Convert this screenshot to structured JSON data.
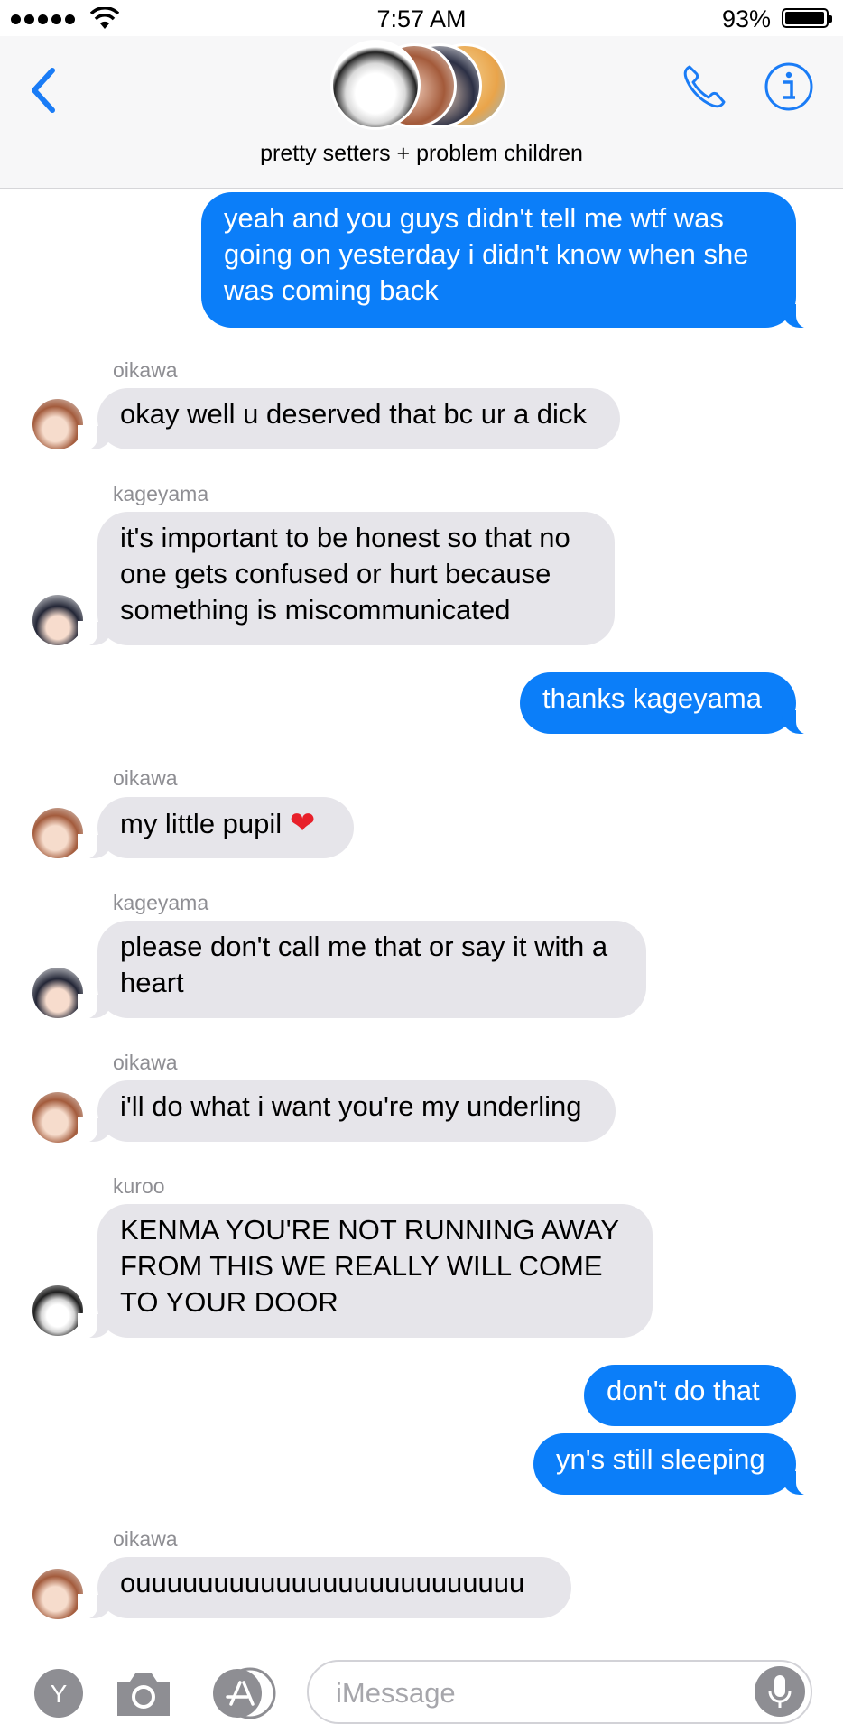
{
  "status_bar": {
    "time": "7:57 AM",
    "battery": "93%"
  },
  "header": {
    "group_name": "pretty setters + problem children",
    "icons": [
      "back-chevron-icon",
      "phone-icon",
      "info-icon"
    ]
  },
  "messages": [
    {
      "from": "me",
      "text_lines": [
        "yeah and you guys didn't tell me wtf was",
        "going on yesterday i didn't know when she",
        "was coming back"
      ]
    },
    {
      "from": "oikawa",
      "sender": "oikawa",
      "text": "okay well u deserved that bc ur a dick"
    },
    {
      "from": "kageyama",
      "sender": "kageyama",
      "text_lines": [
        "it's important to be honest so that no",
        "one gets confused or hurt because",
        "something is miscommunicated"
      ]
    },
    {
      "from": "me",
      "text": "thanks kageyama"
    },
    {
      "from": "oikawa",
      "sender": "oikawa",
      "text": "my little pupil",
      "emoji": "❤"
    },
    {
      "from": "kageyama",
      "sender": "kageyama",
      "text_lines": [
        "please don't call me that or say it with a",
        "heart"
      ]
    },
    {
      "from": "oikawa",
      "sender": "oikawa",
      "text": "i'll do what i want you're my underling"
    },
    {
      "from": "kuroo",
      "sender": "kuroo",
      "text_lines": [
        "KENMA YOU'RE NOT RUNNING AWAY",
        "FROM THIS WE REALLY WILL COME",
        "TO YOUR DOOR"
      ]
    },
    {
      "from": "me",
      "text": "don't do that"
    },
    {
      "from": "me",
      "text": "yn's still sleeping"
    },
    {
      "from": "oikawa",
      "sender": "oikawa",
      "text": "ouuuuuuuuuuuuuuuuuuuuuuuuu"
    }
  ],
  "input": {
    "placeholder": "iMessage",
    "left_button_glyph": "Y"
  },
  "colors": {
    "outgoing": "#0b7ef9",
    "incoming": "#e6e5ea",
    "accent": "#1a7cf6"
  }
}
